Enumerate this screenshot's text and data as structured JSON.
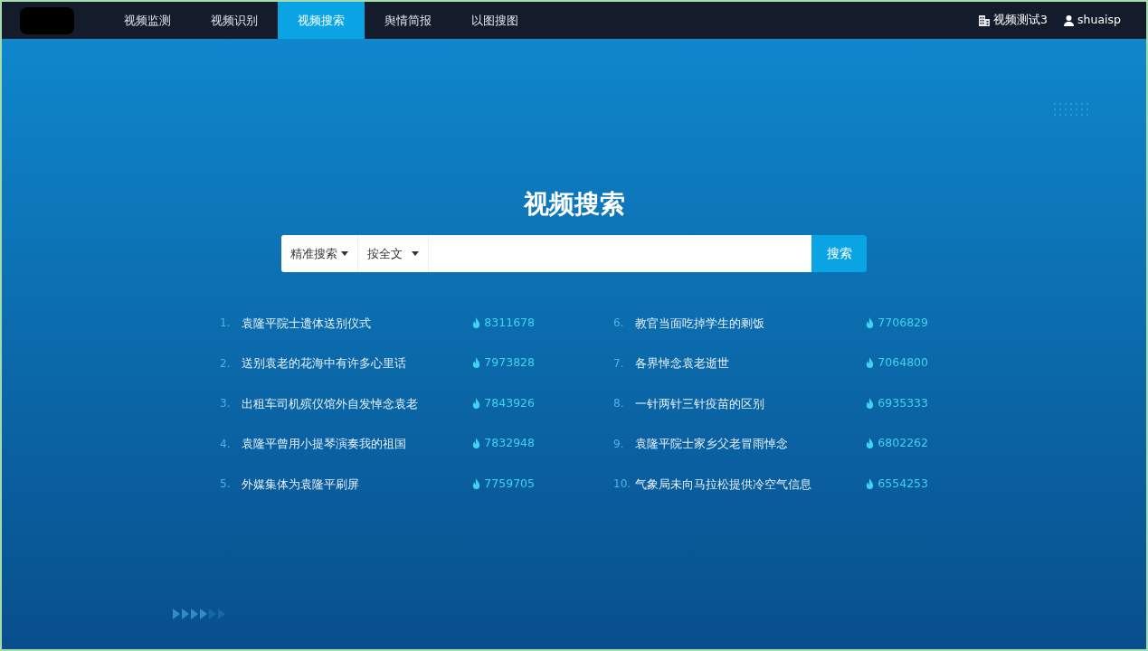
{
  "nav": {
    "items": [
      {
        "label": "视频监测",
        "selected": false
      },
      {
        "label": "视频识别",
        "selected": false
      },
      {
        "label": "视频搜索",
        "selected": true
      },
      {
        "label": "舆情简报",
        "selected": false
      },
      {
        "label": "以图搜图",
        "selected": false
      }
    ],
    "org": "视频测试3",
    "user": "shuaisp"
  },
  "search": {
    "title": "视频搜索",
    "mode": "精准搜索",
    "scope": "按全文",
    "button": "搜索"
  },
  "hot_list": [
    {
      "rank": "1.",
      "title": "袁隆平院士遗体送别仪式",
      "count": "8311678"
    },
    {
      "rank": "2.",
      "title": "送别袁老的花海中有许多心里话",
      "count": "7973828"
    },
    {
      "rank": "3.",
      "title": "出租车司机殡仪馆外自发悼念袁老",
      "count": "7843926"
    },
    {
      "rank": "4.",
      "title": "袁隆平曾用小提琴演奏我的祖国",
      "count": "7832948"
    },
    {
      "rank": "5.",
      "title": "外媒集体为袁隆平刷屏",
      "count": "7759705"
    },
    {
      "rank": "6.",
      "title": "教官当面吃掉学生的剩饭",
      "count": "7706829"
    },
    {
      "rank": "7.",
      "title": "各界悼念袁老逝世",
      "count": "7064800"
    },
    {
      "rank": "8.",
      "title": "一针两针三针疫苗的区别",
      "count": "6935333"
    },
    {
      "rank": "9.",
      "title": "袁隆平院士家乡父老冒雨悼念",
      "count": "6802262"
    },
    {
      "rank": "10.",
      "title": "气象局未向马拉松提供冷空气信息",
      "count": "6554253"
    }
  ]
}
